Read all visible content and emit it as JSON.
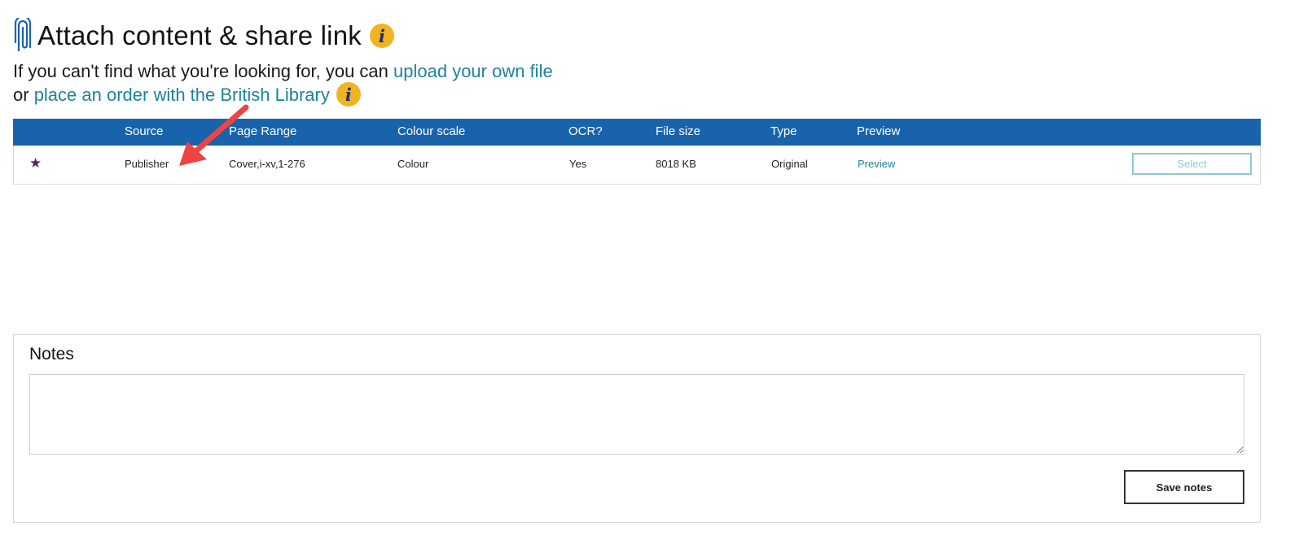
{
  "header": {
    "title": "Attach content & share link",
    "icon": "paperclip-icon",
    "info_icon_glyph": "i"
  },
  "intro": {
    "line1_prefix": "If you can't find what you're looking for, you can ",
    "upload_link": "upload your own file",
    "line2_prefix": "or ",
    "order_link": "place an order with the British Library",
    "info_icon_glyph": "i"
  },
  "table": {
    "columns": [
      "Source",
      "Page Range",
      "Colour scale",
      "OCR?",
      "File size",
      "Type",
      "Preview"
    ],
    "rows": [
      {
        "starred": "★",
        "source": "Publisher",
        "page_range": "Cover,i-xv,1-276",
        "colour_scale": "Colour",
        "ocr": "Yes",
        "file_size": "8018 KB",
        "type": "Original",
        "preview": "Preview",
        "select_label": "Select"
      }
    ]
  },
  "notes": {
    "title": "Notes",
    "value": "",
    "save_label": "Save notes"
  },
  "colors": {
    "header_bg": "#1863ab",
    "link": "#1c8499",
    "info_icon_bg": "#f0b323",
    "annotation_arrow": "#ef4444",
    "star": "#5a1e6b"
  }
}
